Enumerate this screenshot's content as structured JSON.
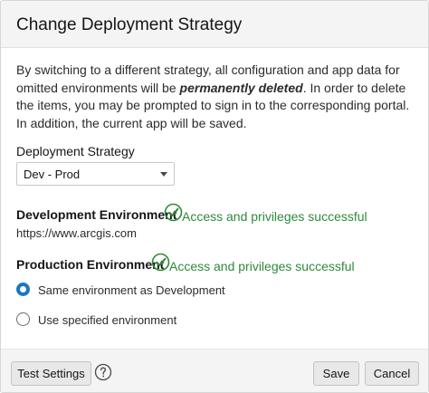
{
  "dialog": {
    "title": "Change Deployment Strategy",
    "description": {
      "part1": "By switching to a different strategy, all configuration and app data for omitted environments will be ",
      "emphasis": "permanently deleted",
      "part2": ". In order to delete the items, you may be prompted to sign in to the corresponding portal. In addition, the current app will be saved."
    }
  },
  "strategy": {
    "label": "Deployment Strategy",
    "selected": "Dev - Prod"
  },
  "development": {
    "title": "Development Environment",
    "status": "Access and privileges successful",
    "url": "https://www.arcgis.com"
  },
  "production": {
    "title": "Production Environment",
    "status": "Access and privileges successful",
    "options": [
      {
        "label": "Same environment as Development",
        "selected": true
      },
      {
        "label": "Use specified environment",
        "selected": false
      }
    ]
  },
  "footer": {
    "test_label": "Test Settings",
    "save_label": "Save",
    "cancel_label": "Cancel"
  },
  "icons": {
    "status": "check-circle-icon",
    "help": "help-circle-icon",
    "dropdown": "chevron-down-icon"
  },
  "colors": {
    "success": "#2e8a3a",
    "accent": "#1a76c4"
  }
}
